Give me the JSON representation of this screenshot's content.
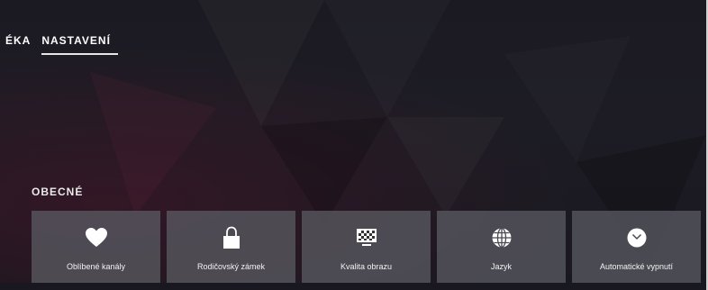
{
  "tabs": [
    {
      "label": "ÉKA"
    },
    {
      "label": "NASTAVENÍ",
      "active": true
    }
  ],
  "section": {
    "title": "OBECNÉ"
  },
  "tiles": [
    {
      "label": "Oblíbené kanály",
      "icon": "heart-icon"
    },
    {
      "label": "Rodičovský zámek",
      "icon": "lock-icon"
    },
    {
      "label": "Kvalita obrazu",
      "icon": "picture-quality-icon"
    },
    {
      "label": "Jazyk",
      "icon": "globe-icon"
    },
    {
      "label": "Automatické vypnutí",
      "icon": "clock-icon"
    }
  ],
  "colors": {
    "tile_bg": "#58585f",
    "background": "#1b1a22",
    "text": "#ffffff"
  }
}
